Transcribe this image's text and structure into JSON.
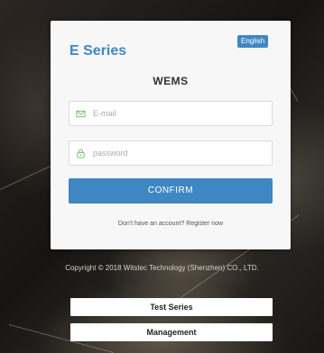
{
  "brand": "E Series",
  "language_button": "English",
  "subtitle": "WEMS",
  "email": {
    "icon": "email-icon",
    "placeholder": "E-mail",
    "value": ""
  },
  "password": {
    "icon": "lock-icon",
    "placeholder": "password",
    "value": ""
  },
  "confirm_label": "CONFIRM",
  "register": {
    "prompt": "Don't have an account?",
    "link": "Register now"
  },
  "copyright": "Copyright © 2018 Witstec Technology (Shenzhen) CO., LTD.",
  "bottom_buttons": {
    "test_series": "Test Series",
    "management": "Management"
  },
  "colors": {
    "accent": "#3f87c3",
    "icon_green": "#6bbf59"
  }
}
